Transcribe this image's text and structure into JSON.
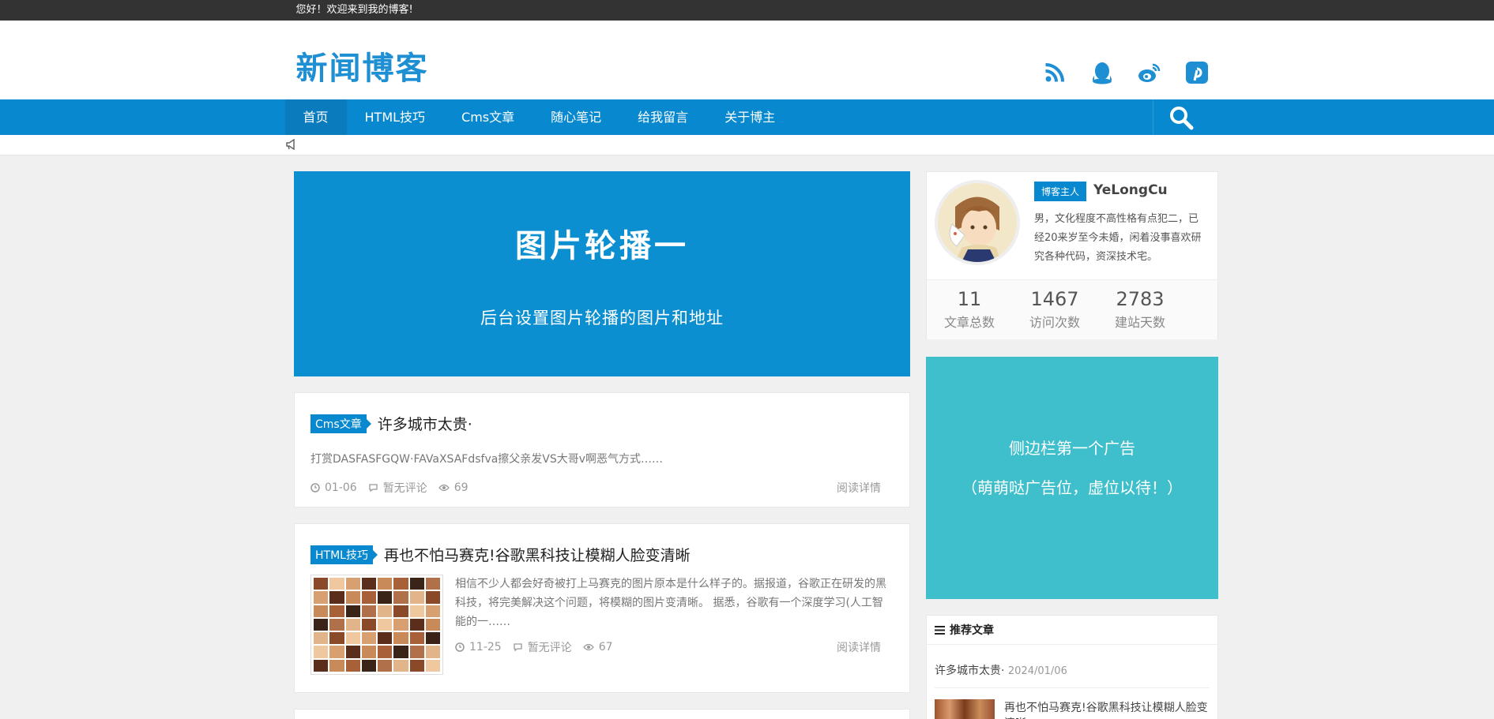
{
  "topbar": {
    "greeting": "您好！欢迎来到我的博客!"
  },
  "header": {
    "logo": "新闻博客",
    "social": [
      "rss-icon",
      "qq-icon",
      "weibo-icon",
      "pinterest-icon"
    ]
  },
  "nav": {
    "items": [
      {
        "label": "首页"
      },
      {
        "label": "HTML技巧"
      },
      {
        "label": "Cms文章"
      },
      {
        "label": "随心笔记"
      },
      {
        "label": "给我留言"
      },
      {
        "label": "关于博主"
      }
    ]
  },
  "banner": {
    "title": "图片轮播一",
    "subtitle": "后台设置图片轮播的图片和地址"
  },
  "posts": [
    {
      "category": "Cms文章",
      "title": "许多城市太贵·",
      "excerpt": "打赏DASFASFGQW·FAVaXSAFdsfva擦父亲发VS大哥v啊恶气方式……",
      "date": "01-06",
      "comments": "暂无评论",
      "views": "69",
      "read": "阅读详情"
    },
    {
      "category": "HTML技巧",
      "title": "再也不怕马赛克!谷歌黑科技让模糊人脸变清晰",
      "excerpt": "相信不少人都会好奇被打上马赛克的图片原本是什么样子的。据报道，谷歌正在研发的黑科技，将完美解决这个问题，将模糊的图片变清晰。 据悉，谷歌有一个深度学习(人工智能的一……",
      "date": "11-25",
      "comments": "暂无评论",
      "views": "67",
      "read": "阅读详情"
    }
  ],
  "profile": {
    "badge": "博客主人",
    "name": "YeLongCu",
    "bio": "男，文化程度不高性格有点犯二，已经20来岁至今未婚，闲着没事喜欢研究各种代码，资深技术宅。",
    "stats": [
      {
        "num": "11",
        "label": "文章总数"
      },
      {
        "num": "1467",
        "label": "访问次数"
      },
      {
        "num": "2783",
        "label": "建站天数"
      }
    ]
  },
  "ad": {
    "line1": "侧边栏第一个广告",
    "line2": "（萌萌哒广告位，虚位以待！）"
  },
  "recommend": {
    "heading": "推荐文章",
    "items": [
      {
        "title": "许多城市太贵·",
        "date": "2024/01/06"
      },
      {
        "title": "再也不怕马赛克!谷歌黑科技让模糊人脸变清晰"
      }
    ]
  },
  "colors": {
    "brand": "#0788cf",
    "ad": "#3ebfcb",
    "topbar": "#333333"
  }
}
